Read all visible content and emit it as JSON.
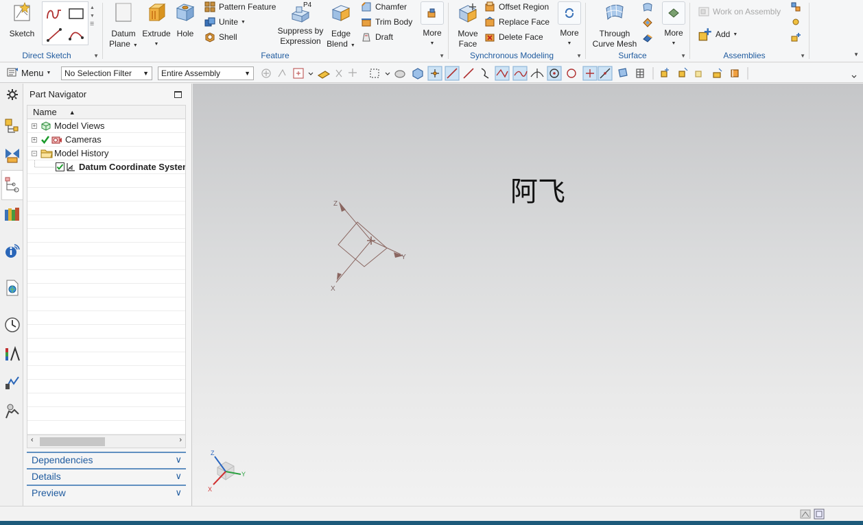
{
  "ribbon": {
    "direct_sketch": {
      "title": "Direct Sketch",
      "sketch": "Sketch"
    },
    "feature": {
      "title": "Feature",
      "datum_plane_1": "Datum",
      "datum_plane_2": "Plane",
      "extrude": "Extrude",
      "hole": "Hole",
      "pattern_feature": "Pattern Feature",
      "unite": "Unite",
      "shell": "Shell",
      "suppress_1": "Suppress by",
      "suppress_2": "Expression",
      "suppress_badge": "P4",
      "edge_blend_1": "Edge",
      "edge_blend_2": "Blend",
      "chamfer": "Chamfer",
      "trim_body": "Trim Body",
      "draft": "Draft",
      "more": "More"
    },
    "sync": {
      "title": "Synchronous Modeling",
      "move_face_1": "Move",
      "move_face_2": "Face",
      "offset_region": "Offset Region",
      "replace_face": "Replace Face",
      "delete_face": "Delete Face",
      "more": "More"
    },
    "surface": {
      "title": "Surface",
      "through_1": "Through",
      "through_2": "Curve Mesh",
      "more": "More"
    },
    "assemblies": {
      "title": "Assemblies",
      "work_on_assembly": "Work on Assembly",
      "add": "Add"
    }
  },
  "toolbar": {
    "menu": "Menu",
    "selection_filter": "No Selection Filter",
    "scope": "Entire Assembly"
  },
  "navigator": {
    "title": "Part Navigator",
    "column_name": "Name",
    "items": [
      {
        "label": "Model Views"
      },
      {
        "label": "Cameras"
      },
      {
        "label": "Model History"
      },
      {
        "label": "Datum Coordinate System"
      }
    ],
    "panels": {
      "dependencies": "Dependencies",
      "details": "Details",
      "preview": "Preview"
    }
  },
  "viewport": {
    "watermark": "阿飞",
    "csys_labels": {
      "x": "X",
      "y": "Y",
      "z": "Z"
    },
    "triad_labels": {
      "x": "X",
      "y": "Y",
      "z": "Z"
    }
  },
  "colors": {
    "accent_blue": "#1e5a9e",
    "csys_brown": "#8a6660",
    "bottom_bar": "#1c5a7a"
  }
}
